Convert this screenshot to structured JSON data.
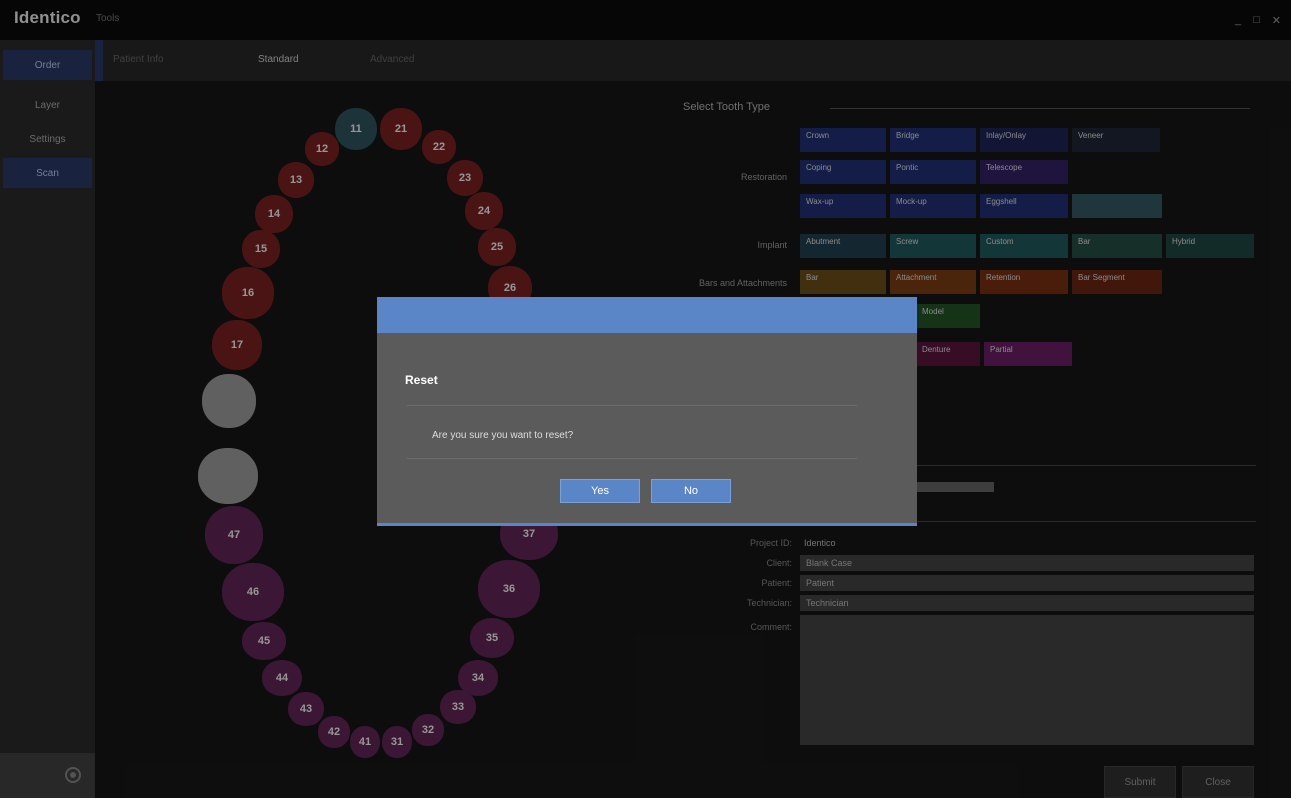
{
  "app": {
    "name": "Identico",
    "subtitle": "Tools"
  },
  "window_controls": [
    "_",
    "□",
    "✕"
  ],
  "sidebar": {
    "items": [
      {
        "label": "Order",
        "active": true
      },
      {
        "label": "Layer"
      },
      {
        "label": "Settings"
      },
      {
        "label": "Scan",
        "active": true
      }
    ]
  },
  "topbar": {
    "tabs": [
      {
        "label": "Patient Info"
      },
      {
        "label": "Standard",
        "active": true
      },
      {
        "label": "Advanced"
      }
    ]
  },
  "teeth": {
    "upper": [
      "11",
      "21",
      "12",
      "22",
      "13",
      "23",
      "14",
      "24",
      "15",
      "25",
      "16",
      "26",
      "17"
    ],
    "lower": [
      "47",
      "46",
      "45",
      "44",
      "43",
      "42",
      "41",
      "31",
      "32",
      "33",
      "34",
      "35",
      "36",
      "37"
    ]
  },
  "tooth_type": {
    "title": "Select Tooth Type",
    "rows": [
      {
        "label": "Restoration",
        "items": [
          "Crown",
          "Bridge",
          "Inlay/Onlay",
          "Veneer",
          "Coping",
          "Pontic",
          "Telescope",
          "Wax-up",
          "Mock-up",
          "Eggshell"
        ]
      },
      {
        "label": "Implant",
        "items": [
          "Abutment",
          "Screw",
          "Custom",
          "Bar",
          "Hybrid"
        ]
      },
      {
        "label": "Bars and Attachments",
        "items": [
          "Bar",
          "Attachment",
          "Retention",
          "Bar Segment"
        ]
      },
      {
        "label": "",
        "items": [
          "Model"
        ]
      },
      {
        "label": "",
        "items": [
          "Denture",
          "Partial"
        ]
      }
    ]
  },
  "fields": {
    "project_label": "Project ID:",
    "project_value": "Identico",
    "client_label": "Client:",
    "client_value": "Blank Case",
    "patient_label": "Patient:",
    "patient_value": "Patient",
    "technician_label": "Technician:",
    "technician_value": "Technician",
    "comment_label": "Comment:",
    "comment_value": ""
  },
  "bottom_buttons": {
    "submit": "Submit",
    "close": "Close"
  },
  "dialog": {
    "title": "Reset",
    "message": "Are you sure you want to reset?",
    "yes_label": "Yes",
    "no_label": "No"
  },
  "colors": {
    "accent": "#5a86c8",
    "tooth_red": "#6a1d1d",
    "tooth_teal": "#274a52",
    "tooth_gray": "#8a8a8a",
    "tooth_purple": "#55204d"
  }
}
